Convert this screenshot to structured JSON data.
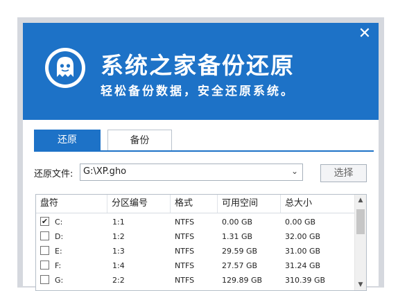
{
  "header": {
    "title": "系统之家备份还原",
    "slogan": "轻松备份数据，安全还原系统。",
    "close_icon": "close-icon",
    "brand_color": "#1d72c7"
  },
  "tabs": [
    {
      "label": "还原",
      "active": true
    },
    {
      "label": "备份",
      "active": false
    }
  ],
  "restore": {
    "file_label": "还原文件:",
    "file_value": "G:\\XP.gho",
    "select_button": "选择"
  },
  "table": {
    "columns": [
      "盘符",
      "分区编号",
      "格式",
      "可用空间",
      "总大小"
    ],
    "rows": [
      {
        "checked": true,
        "drive": "C:",
        "partition": "1:1",
        "format": "NTFS",
        "free": "0.00 GB",
        "total": "0.00 GB"
      },
      {
        "checked": false,
        "drive": "D:",
        "partition": "1:2",
        "format": "NTFS",
        "free": "1.31 GB",
        "total": "32.00 GB"
      },
      {
        "checked": false,
        "drive": "E:",
        "partition": "1:3",
        "format": "NTFS",
        "free": "29.59 GB",
        "total": "31.00 GB"
      },
      {
        "checked": false,
        "drive": "F:",
        "partition": "1:4",
        "format": "NTFS",
        "free": "27.57 GB",
        "total": "31.24 GB"
      },
      {
        "checked": false,
        "drive": "G:",
        "partition": "2:2",
        "format": "NTFS",
        "free": "129.89 GB",
        "total": "310.39 GB"
      }
    ]
  }
}
